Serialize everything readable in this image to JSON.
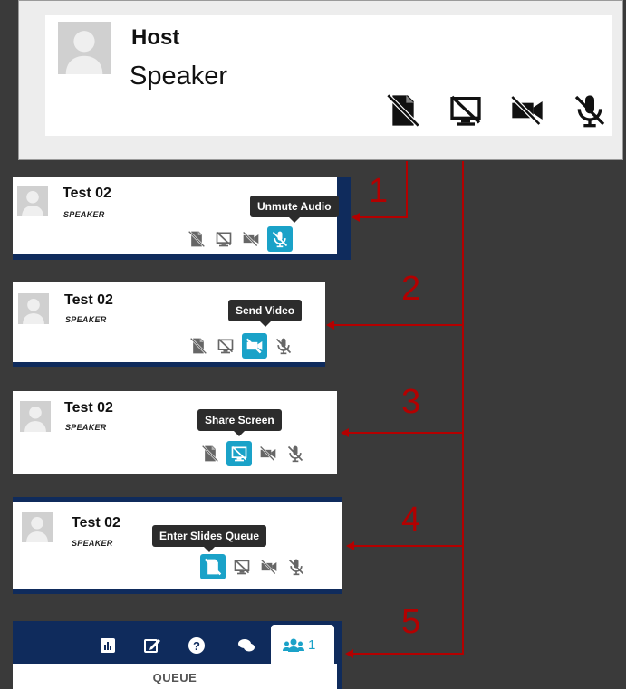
{
  "host": {
    "name": "Host",
    "role": "Speaker"
  },
  "cards": [
    {
      "name": "Test 02",
      "role": "SPEAKER",
      "tooltip": "Unmute Audio",
      "active": "mic"
    },
    {
      "name": "Test 02",
      "role": "SPEAKER",
      "tooltip": "Send Video",
      "active": "video"
    },
    {
      "name": "Test 02",
      "role": "SPEAKER",
      "tooltip": "Share Screen",
      "active": "screen"
    },
    {
      "name": "Test 02",
      "role": "SPEAKER",
      "tooltip": "Enter Slides Queue",
      "active": "slides"
    }
  ],
  "callouts": [
    "1",
    "2",
    "3",
    "4",
    "5"
  ],
  "queue": {
    "tab_count": "1",
    "label": "QUEUE"
  },
  "icons": [
    "slides-off-icon",
    "screen-share-off-icon",
    "video-off-icon",
    "mic-off-icon"
  ],
  "colors": {
    "accent": "#1aa2c8",
    "navy": "#0f2b5c",
    "callout_red": "#b30000"
  }
}
